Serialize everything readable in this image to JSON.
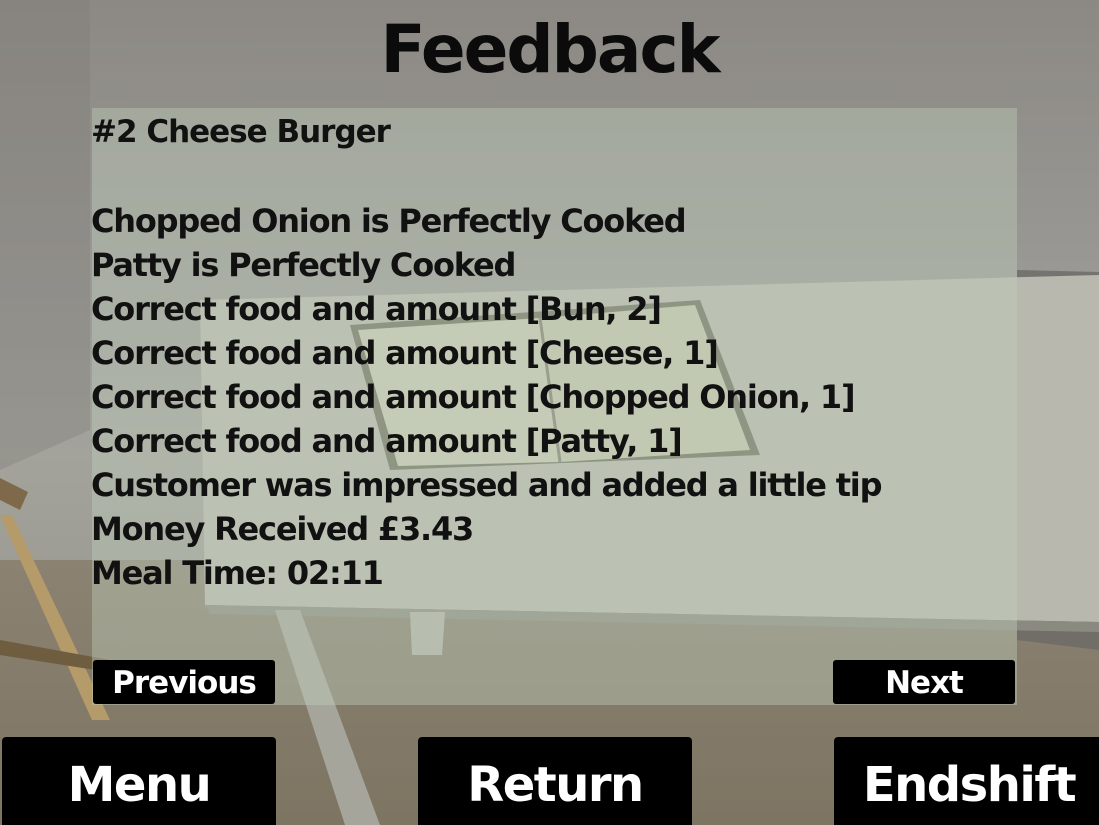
{
  "screen": {
    "title": "Feedback"
  },
  "feedback": {
    "order_title": "#2 Cheese Burger",
    "lines": [
      "Chopped Onion is Perfectly Cooked",
      "Patty is Perfectly Cooked",
      "Correct food and amount [Bun, 2]",
      "Correct food and amount [Cheese, 1]",
      "Correct food and amount [Chopped Onion, 1]",
      "Correct food and amount [Patty, 1]",
      "Customer was impressed and added a little tip",
      "Money Received £3.43",
      "Meal Time: 02:11"
    ]
  },
  "nav": {
    "previous_label": "Previous",
    "next_label": "Next"
  },
  "bottom_bar": {
    "menu_label": "Menu",
    "return_label": "Return",
    "endshift_label": "Endshift"
  },
  "colors": {
    "button_bg": "#000000",
    "button_text": "#ffffff",
    "title_text": "#0b0b0b"
  }
}
